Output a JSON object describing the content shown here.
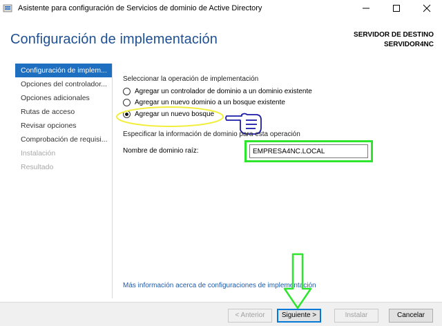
{
  "window": {
    "title": "Asistente para configuración de Servicios de dominio de Active Directory"
  },
  "header": {
    "page_title": "Configuración de implementación",
    "server_label": "SERVIDOR DE DESTINO",
    "server_name": "SERVIDOR4NC"
  },
  "nav": {
    "items": [
      {
        "label": "Configuración de implem...",
        "state": "active"
      },
      {
        "label": "Opciones del controlador...",
        "state": "normal"
      },
      {
        "label": "Opciones adicionales",
        "state": "normal"
      },
      {
        "label": "Rutas de acceso",
        "state": "normal"
      },
      {
        "label": "Revisar opciones",
        "state": "normal"
      },
      {
        "label": "Comprobación de requisi...",
        "state": "normal"
      },
      {
        "label": "Instalación",
        "state": "disabled"
      },
      {
        "label": "Resultado",
        "state": "disabled"
      }
    ]
  },
  "operation": {
    "heading": "Seleccionar la operación de implementación",
    "options": [
      {
        "label": "Agregar un controlador de dominio a un dominio existente",
        "checked": false
      },
      {
        "label": "Agregar un nuevo dominio a un bosque existente",
        "checked": false
      },
      {
        "label": "Agregar un nuevo bosque",
        "checked": true
      }
    ]
  },
  "domain": {
    "heading": "Especificar la información de dominio para esta operación",
    "root_label": "Nombre de dominio raíz:",
    "root_value": "EMPRESA4NC.LOCAL"
  },
  "more_info_link": "Más información acerca de configuraciones de implementación",
  "buttons": {
    "previous": "< Anterior",
    "next": "Siguiente >",
    "install": "Instalar",
    "cancel": "Cancelar"
  },
  "colors": {
    "title_blue": "#1e4f91",
    "nav_active": "#1f6fc1",
    "highlight_green": "#2ee52e",
    "highlight_yellow": "#f2ee3c",
    "hand_blue": "#1a1aa8"
  }
}
